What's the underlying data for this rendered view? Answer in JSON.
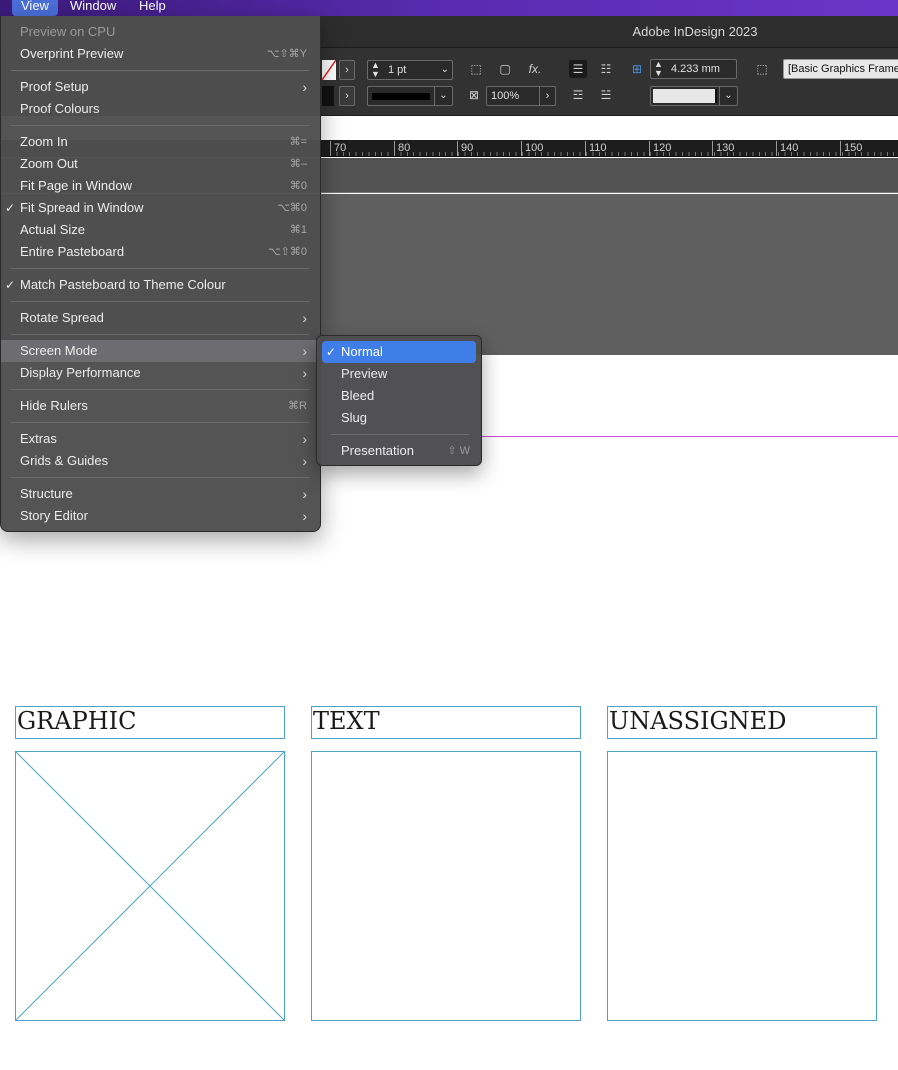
{
  "menubar": {
    "items": [
      "View",
      "Window",
      "Help"
    ]
  },
  "app": {
    "title": "Adobe InDesign 2023"
  },
  "control_bar": {
    "stroke_weight": "1 pt",
    "zoom_percent": "100%",
    "fx_label": "fx.",
    "spacing_value": "4.233 mm",
    "object_style": "[Basic Graphics Frame"
  },
  "ruler": {
    "ticks": [
      "70",
      "80",
      "90",
      "100",
      "110",
      "120",
      "130",
      "140",
      "150"
    ]
  },
  "view_menu": {
    "items": [
      {
        "label": "Preview on CPU",
        "shortcut": "",
        "disabled": true
      },
      {
        "label": "Overprint Preview",
        "shortcut": "⌥⇧⌘Y"
      },
      {
        "label": "Proof Setup",
        "submenu": true
      },
      {
        "label": "Proof Colours",
        "shortcut": ""
      },
      {
        "label": "Zoom In",
        "shortcut": "⌘="
      },
      {
        "label": "Zoom Out",
        "shortcut": "⌘–"
      },
      {
        "label": "Fit Page in Window",
        "shortcut": "⌘0"
      },
      {
        "label": "Fit Spread in Window",
        "shortcut": "⌥⌘0",
        "checked": true
      },
      {
        "label": "Actual Size",
        "shortcut": "⌘1"
      },
      {
        "label": "Entire Pasteboard",
        "shortcut": "⌥⇧⌘0"
      },
      {
        "label": "Match Pasteboard to Theme Colour",
        "checked": true
      },
      {
        "label": "Rotate Spread",
        "submenu": true
      },
      {
        "label": "Screen Mode",
        "submenu": true,
        "highlighted": true
      },
      {
        "label": "Display Performance",
        "submenu": true
      },
      {
        "label": "Hide Rulers",
        "shortcut": "⌘R"
      },
      {
        "label": "Extras",
        "submenu": true
      },
      {
        "label": "Grids & Guides",
        "submenu": true
      },
      {
        "label": "Structure",
        "submenu": true
      },
      {
        "label": "Story Editor",
        "submenu": true
      }
    ]
  },
  "screen_mode_submenu": {
    "items": [
      {
        "label": "Normal",
        "checked": true,
        "selected": true
      },
      {
        "label": "Preview"
      },
      {
        "label": "Bleed"
      },
      {
        "label": "Slug"
      },
      {
        "label": "Presentation",
        "shortcut": "⇧ W"
      }
    ]
  },
  "page": {
    "frames": [
      {
        "label": "GRAPHIC",
        "type": "graphic"
      },
      {
        "label": "TEXT",
        "type": "text"
      },
      {
        "label": "UNASSIGNED",
        "type": "unassigned"
      }
    ]
  },
  "colors": {
    "accent": "#3f7ee8",
    "frame_border": "#4aa3c9",
    "margin_guide": "#d04ad8"
  }
}
